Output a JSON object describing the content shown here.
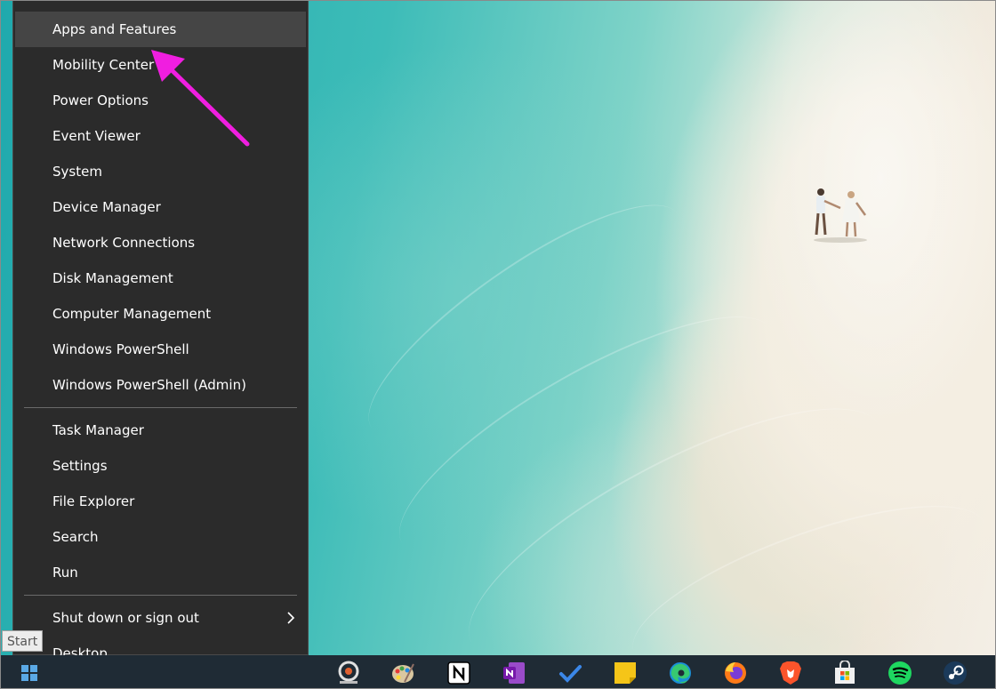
{
  "menu": {
    "group1": [
      {
        "name": "menu-item-apps-and-features",
        "label": "Apps and Features"
      },
      {
        "name": "menu-item-mobility-center",
        "label": "Mobility Center"
      },
      {
        "name": "menu-item-power-options",
        "label": "Power Options"
      },
      {
        "name": "menu-item-event-viewer",
        "label": "Event Viewer"
      },
      {
        "name": "menu-item-system",
        "label": "System"
      },
      {
        "name": "menu-item-device-manager",
        "label": "Device Manager"
      },
      {
        "name": "menu-item-network-connections",
        "label": "Network Connections"
      },
      {
        "name": "menu-item-disk-management",
        "label": "Disk Management"
      },
      {
        "name": "menu-item-computer-management",
        "label": "Computer Management"
      },
      {
        "name": "menu-item-windows-powershell",
        "label": "Windows PowerShell"
      },
      {
        "name": "menu-item-windows-powershell-admin",
        "label": "Windows PowerShell (Admin)"
      }
    ],
    "group2": [
      {
        "name": "menu-item-task-manager",
        "label": "Task Manager"
      },
      {
        "name": "menu-item-settings",
        "label": "Settings"
      },
      {
        "name": "menu-item-file-explorer",
        "label": "File Explorer"
      },
      {
        "name": "menu-item-search",
        "label": "Search"
      },
      {
        "name": "menu-item-run",
        "label": "Run"
      }
    ],
    "group3": [
      {
        "name": "menu-item-shut-down-or-sign-out",
        "label": "Shut down or sign out"
      },
      {
        "name": "menu-item-desktop",
        "label": "Desktop"
      }
    ],
    "highlighted": "Apps and Features"
  },
  "tooltip": {
    "label": "Start"
  },
  "taskbar": {
    "icons": [
      "inkscape-icon",
      "paint-palette-icon",
      "notion-icon",
      "onenote-icon",
      "todo-check-icon",
      "sticky-notes-icon",
      "edge-icon",
      "firefox-icon",
      "brave-icon",
      "microsoft-store-icon",
      "spotify-icon",
      "steam-icon"
    ]
  },
  "colors": {
    "menu_bg": "#2b2b2b",
    "menu_highlight": "#454545",
    "annotation_arrow": "#f01ee0",
    "taskbar_bg": "#1f2b35"
  }
}
